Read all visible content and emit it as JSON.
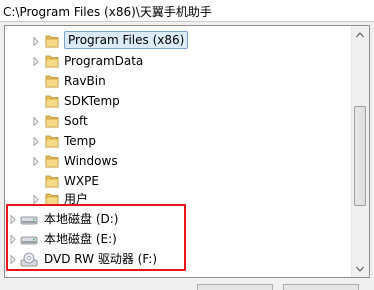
{
  "path_field": {
    "value": "C:\\Program Files (x86)\\天翼手机助手"
  },
  "tree": {
    "items": [
      {
        "label": "Program Files (x86)",
        "icon": "folder-icon",
        "expandable": true,
        "selected": true
      },
      {
        "label": "ProgramData",
        "icon": "folder-icon",
        "expandable": true,
        "selected": false
      },
      {
        "label": "RavBin",
        "icon": "folder-icon",
        "expandable": false,
        "selected": false
      },
      {
        "label": "SDKTemp",
        "icon": "folder-icon",
        "expandable": false,
        "selected": false
      },
      {
        "label": "Soft",
        "icon": "folder-icon",
        "expandable": true,
        "selected": false
      },
      {
        "label": "Temp",
        "icon": "folder-icon",
        "expandable": true,
        "selected": false
      },
      {
        "label": "Windows",
        "icon": "folder-icon",
        "expandable": true,
        "selected": false
      },
      {
        "label": "WXPE",
        "icon": "folder-icon",
        "expandable": false,
        "selected": false
      },
      {
        "label": "用户",
        "icon": "folder-icon",
        "expandable": true,
        "selected": false
      }
    ],
    "drives": [
      {
        "label": "本地磁盘 (D:)",
        "icon": "hard-drive-icon"
      },
      {
        "label": "本地磁盘 (E:)",
        "icon": "hard-drive-icon"
      },
      {
        "label": "DVD RW 驱动器 (F:)",
        "icon": "dvd-drive-icon"
      }
    ]
  },
  "colors": {
    "highlight_box": "#e8161c",
    "selection_fill": "#dcebfc",
    "folder": "#e8c25a"
  }
}
